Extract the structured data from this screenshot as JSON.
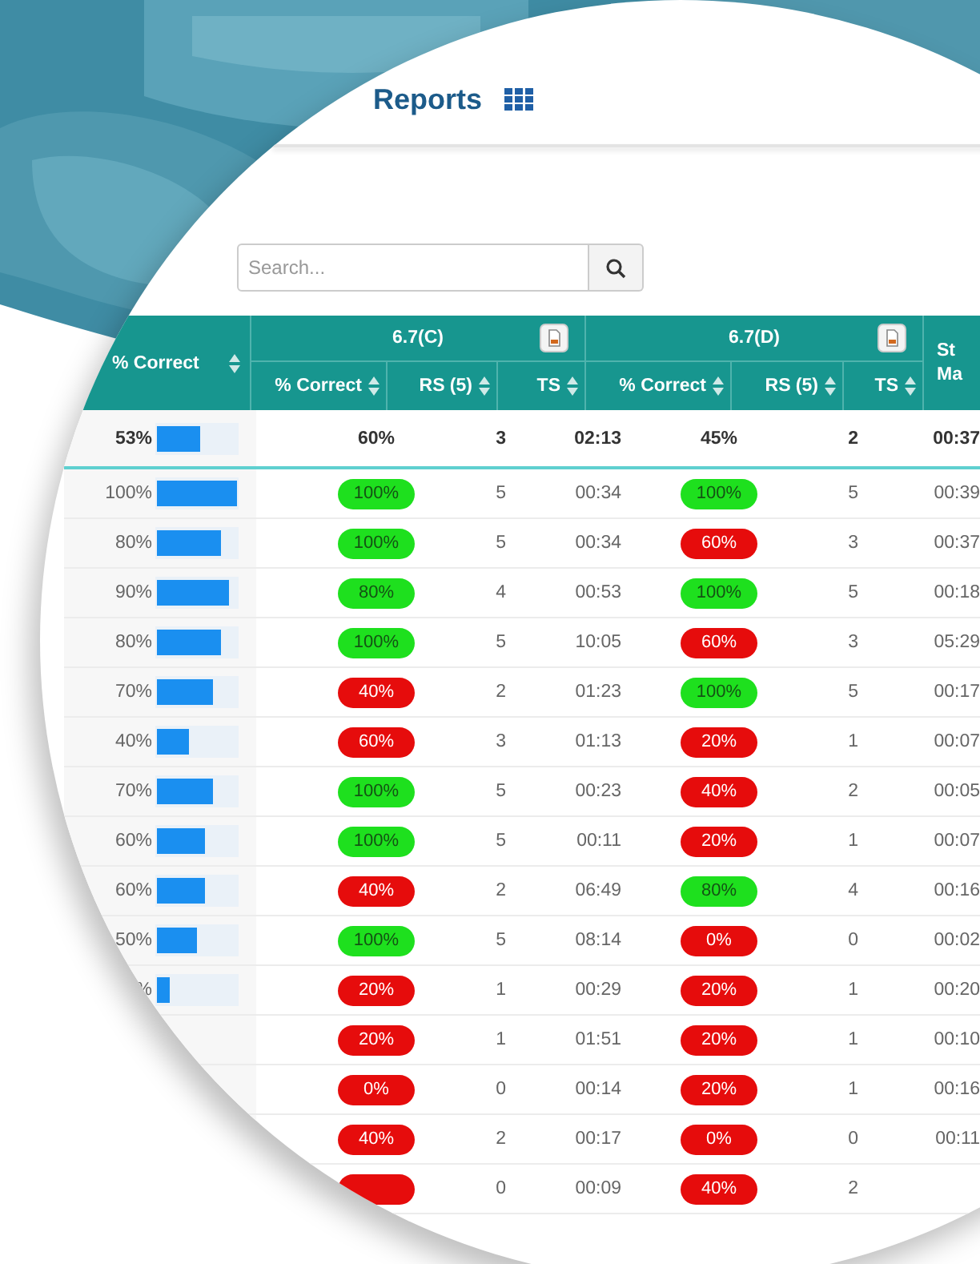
{
  "header": {
    "title": "Reports"
  },
  "search": {
    "placeholder": "Search..."
  },
  "table": {
    "first_column": "% Correct",
    "last_column": "St Ma",
    "groups": [
      {
        "title": "6.7(C)",
        "columns": [
          "% Correct",
          "RS (5)",
          "TS"
        ]
      },
      {
        "title": "6.7(D)",
        "columns": [
          "% Correct",
          "RS (5)",
          "TS"
        ]
      }
    ],
    "total": {
      "percent": "53%",
      "level": 0.53,
      "groups": [
        {
          "percent": "60%",
          "rs": "3",
          "ts": "02:13"
        },
        {
          "percent": "45%",
          "rs": "2",
          "ts": "00:37"
        }
      ]
    },
    "rows": [
      {
        "percent": "100%",
        "level": 1,
        "groups": [
          {
            "percent": "100%",
            "pass": true,
            "rs": "5",
            "ts": "00:34"
          },
          {
            "percent": "100%",
            "pass": true,
            "rs": "5",
            "ts": "00:39"
          }
        ]
      },
      {
        "percent": "80%",
        "level": 0.8,
        "groups": [
          {
            "percent": "100%",
            "pass": true,
            "rs": "5",
            "ts": "00:34"
          },
          {
            "percent": "60%",
            "pass": false,
            "rs": "3",
            "ts": "00:37"
          }
        ]
      },
      {
        "percent": "90%",
        "level": 0.9,
        "groups": [
          {
            "percent": "80%",
            "pass": true,
            "rs": "4",
            "ts": "00:53"
          },
          {
            "percent": "100%",
            "pass": true,
            "rs": "5",
            "ts": "00:18"
          }
        ]
      },
      {
        "percent": "80%",
        "level": 0.8,
        "groups": [
          {
            "percent": "100%",
            "pass": true,
            "rs": "5",
            "ts": "10:05"
          },
          {
            "percent": "60%",
            "pass": false,
            "rs": "3",
            "ts": "05:29"
          }
        ]
      },
      {
        "percent": "70%",
        "level": 0.7,
        "groups": [
          {
            "percent": "40%",
            "pass": false,
            "rs": "2",
            "ts": "01:23"
          },
          {
            "percent": "100%",
            "pass": true,
            "rs": "5",
            "ts": "00:17"
          }
        ]
      },
      {
        "percent": "40%",
        "level": 0.4,
        "groups": [
          {
            "percent": "60%",
            "pass": false,
            "rs": "3",
            "ts": "01:13"
          },
          {
            "percent": "20%",
            "pass": false,
            "rs": "1",
            "ts": "00:07"
          }
        ]
      },
      {
        "percent": "70%",
        "level": 0.7,
        "groups": [
          {
            "percent": "100%",
            "pass": true,
            "rs": "5",
            "ts": "00:23"
          },
          {
            "percent": "40%",
            "pass": false,
            "rs": "2",
            "ts": "00:05"
          }
        ]
      },
      {
        "percent": "60%",
        "level": 0.6,
        "groups": [
          {
            "percent": "100%",
            "pass": true,
            "rs": "5",
            "ts": "00:11"
          },
          {
            "percent": "20%",
            "pass": false,
            "rs": "1",
            "ts": "00:07"
          }
        ]
      },
      {
        "percent": "60%",
        "level": 0.6,
        "groups": [
          {
            "percent": "40%",
            "pass": false,
            "rs": "2",
            "ts": "06:49"
          },
          {
            "percent": "80%",
            "pass": true,
            "rs": "4",
            "ts": "00:16"
          }
        ]
      },
      {
        "percent": "50%",
        "level": 0.5,
        "groups": [
          {
            "percent": "100%",
            "pass": true,
            "rs": "5",
            "ts": "08:14"
          },
          {
            "percent": "0%",
            "pass": false,
            "rs": "0",
            "ts": "00:02"
          }
        ]
      },
      {
        "percent": "%",
        "level": 0.15,
        "groups": [
          {
            "percent": "20%",
            "pass": false,
            "rs": "1",
            "ts": "00:29"
          },
          {
            "percent": "20%",
            "pass": false,
            "rs": "1",
            "ts": "00:20"
          }
        ]
      },
      {
        "groups": [
          {
            "percent": "20%",
            "pass": false,
            "rs": "1",
            "ts": "01:51"
          },
          {
            "percent": "20%",
            "pass": false,
            "rs": "1",
            "ts": "00:10"
          }
        ]
      },
      {
        "groups": [
          {
            "percent": "0%",
            "pass": false,
            "rs": "0",
            "ts": "00:14"
          },
          {
            "percent": "20%",
            "pass": false,
            "rs": "1",
            "ts": "00:16"
          }
        ]
      },
      {
        "groups": [
          {
            "percent": "40%",
            "pass": false,
            "rs": "2",
            "ts": "00:17"
          },
          {
            "percent": "0%",
            "pass": false,
            "rs": "0",
            "ts": "00:11"
          }
        ]
      },
      {
        "groups": [
          {
            "pass": false,
            "rs": "0",
            "ts": "00:09"
          },
          {
            "percent": "40%",
            "pass": false,
            "rs": "2"
          }
        ]
      }
    ]
  }
}
